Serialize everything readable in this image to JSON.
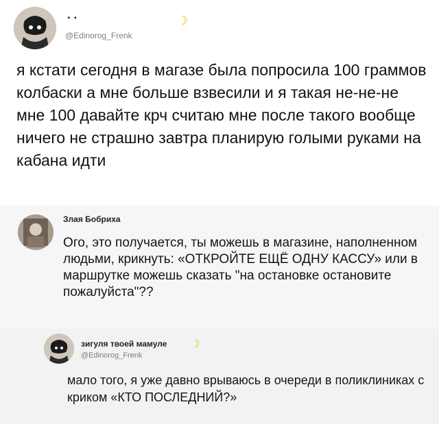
{
  "post": {
    "author_name": ". .",
    "handle": "@Edinorog_Frenk",
    "text": "я кстати сегодня в магазе была попросила 100 граммов колбаски а мне больше взвесили и я такая не-не-не мне 100 давайте крч считаю мне после такого вообще ничего не страшно завтра планирую голыми руками на кабана идти",
    "moon_emoji": "☽"
  },
  "reply1": {
    "author_name": "Злая Бобриха",
    "text": "Ого, это получается, ты можешь в магазине, наполненном людьми, крикнуть: «ОТКРОЙТЕ ЕЩЁ ОДНУ КАССУ» или в маршрутке можешь сказать \"на остановке остановите пожалуйста\"??"
  },
  "reply2": {
    "author_name": "зигуля твоей мамуле",
    "handle": "@Edinorog_Frenk",
    "text": "мало того, я уже давно врываюсь в очереди в поликлиниках с криком «КТО ПОСЛЕДНИЙ?»",
    "moon_emoji": "☽"
  },
  "icons": {
    "avatar_main": "cartoon-avatar-icon",
    "avatar_r1": "photo-avatar-icon",
    "avatar_r2": "cartoon-avatar-icon"
  },
  "colors": {
    "moon": "#e7c500",
    "handle": "#7d7d7d"
  }
}
